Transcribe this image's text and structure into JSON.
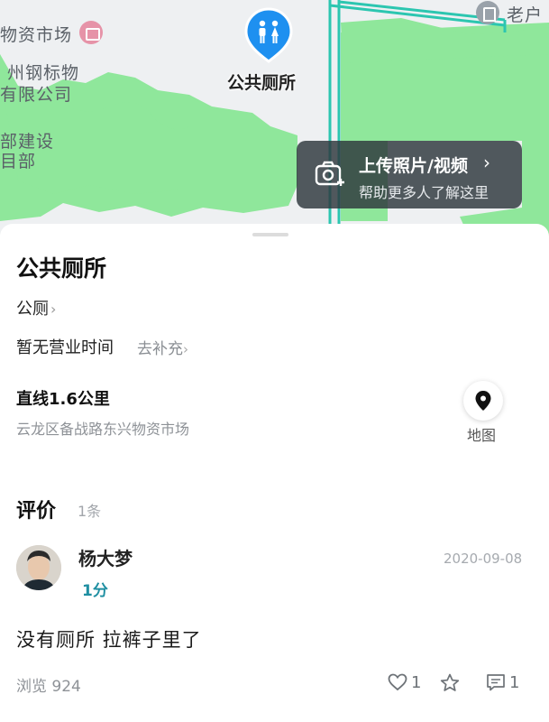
{
  "map": {
    "labels": {
      "market": "物资市场",
      "company_line1": "州钢标物",
      "company_line2": "有限公司",
      "dept_line1": "部建设",
      "dept_line2": "目部",
      "village": "老户"
    },
    "poi_name": "公共厕所",
    "upload_card": {
      "title": "上传照片/视频",
      "chevron": "›",
      "subtitle": "帮助更多人了解这里"
    },
    "colors": {
      "green": "#8fe79b",
      "road": "#2cc6b0",
      "poi": "#1e90f0"
    }
  },
  "place": {
    "title": "公共厕所",
    "category": "公厕",
    "hours": "暂无营业时间",
    "hours_link": "去补充",
    "distance": "直线1.6公里",
    "address": "云龙区备战路东兴物资市场",
    "map_button_label": "地图"
  },
  "reviews": {
    "title": "评价",
    "count": "1条",
    "items": [
      {
        "author": "杨大梦",
        "rating": "1分",
        "date": "2020-09-08",
        "text": "没有厕所  拉裤子里了"
      }
    ]
  },
  "footer": {
    "views": "浏览 924",
    "likes": "1",
    "comments": "1"
  },
  "icons": [
    "toilet-icon",
    "shop-icon",
    "village-icon",
    "camera-icon",
    "location-pin-icon",
    "heart-icon",
    "star-icon",
    "comment-icon"
  ]
}
